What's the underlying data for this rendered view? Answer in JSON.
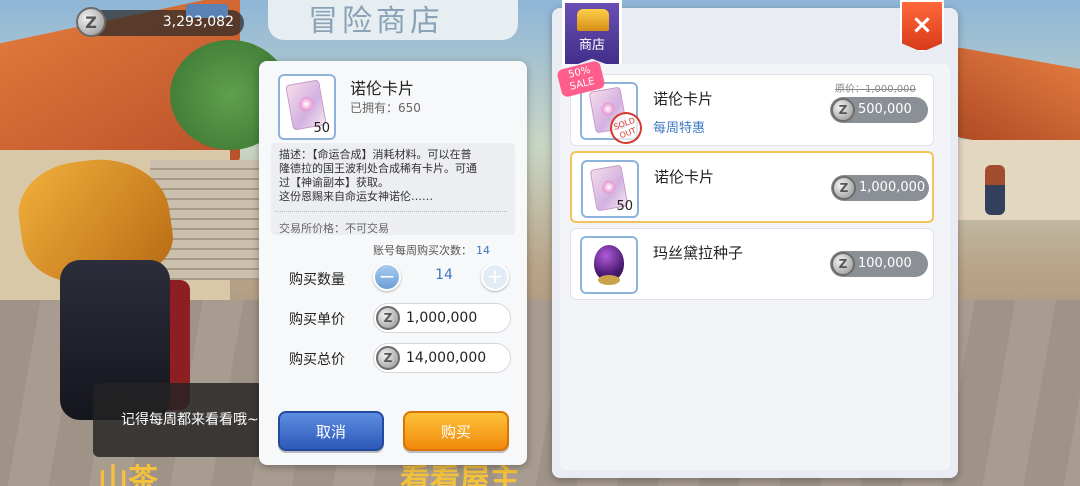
{
  "currency": {
    "icon": "z-coin-icon",
    "amount": "3,293,082"
  },
  "background": {
    "sign_text": "冒险商店",
    "bottom_text_left": "山茶",
    "bottom_text_right": "看看屋主"
  },
  "dialog": {
    "item_name": "诺伦卡片",
    "item_quantity": "50",
    "owned_label": "已拥有：",
    "owned_count": "650",
    "description_lines": [
      "描述：【命运合成】消耗材料。可以在普",
      "隆德拉的国王波利处合成稀有卡片。可通",
      "过【神谕副本】获取。",
      "这份恩赐来自命运女神诺伦……"
    ],
    "trade_note": "交易所价格：不可交易",
    "weekly_limit_label": "账号每周购买次数：",
    "weekly_limit_value": "14",
    "quantity_label": "购买数量",
    "quantity_value": "14",
    "unit_price_label": "购买单价",
    "unit_price": "1,000,000",
    "total_price_label": "购买总价",
    "total_price": "14,000,000",
    "cancel_label": "取消",
    "buy_label": "购买"
  },
  "toast": {
    "text": "记得每周都来看看哦~"
  },
  "shop": {
    "title": "商店",
    "close_label": "×",
    "items": [
      {
        "name": "诺伦卡片",
        "subtitle": "每周特惠",
        "original_price": "原价：1,000,000",
        "price": "500,000",
        "sale_tag": "50% SALE",
        "stamp": "SOLD OUT"
      },
      {
        "name": "诺伦卡片",
        "quantity": "50",
        "price": "1,000,000"
      },
      {
        "name": "玛丝黛拉种子",
        "price": "100,000"
      }
    ]
  },
  "colors": {
    "accent_blue": "#3c78c0",
    "buy_orange": "#f08a0c",
    "cancel_blue": "#2e59b9",
    "close_red": "#d83a1a",
    "selected_border": "#f2c35a"
  }
}
